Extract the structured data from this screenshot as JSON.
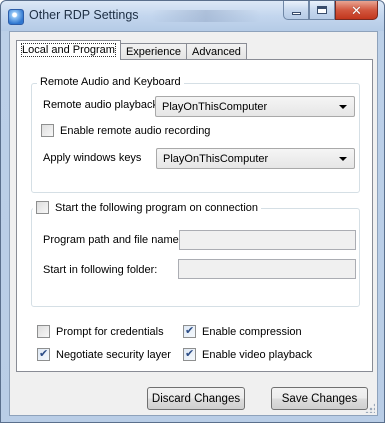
{
  "window": {
    "title": "Other RDP Settings",
    "buttons": {
      "minimize": "minimize",
      "maximize": "maximize",
      "close": "close"
    }
  },
  "tabs": [
    {
      "label": "Local and Program",
      "active": true
    },
    {
      "label": "Experience",
      "active": false
    },
    {
      "label": "Advanced",
      "active": false
    }
  ],
  "audio_group": {
    "title": "Remote Audio and Keyboard",
    "playback_label": "Remote audio playback:",
    "playback_value": "PlayOnThisComputer",
    "recording_label": "Enable remote audio recording",
    "recording_checked": false,
    "keys_label": "Apply windows keys",
    "keys_value": "PlayOnThisComputer"
  },
  "program_group": {
    "title": "Start the following program on connection",
    "title_checked": false,
    "path_label": "Program path and file name:",
    "path_value": "",
    "folder_label": "Start in following folder:",
    "folder_value": ""
  },
  "options": {
    "prompt_credentials": {
      "label": "Prompt for credentials",
      "checked": false
    },
    "enable_compression": {
      "label": "Enable compression",
      "checked": true
    },
    "negotiate_security": {
      "label": "Negotiate security layer",
      "checked": true
    },
    "enable_video": {
      "label": "Enable video playback",
      "checked": true
    }
  },
  "footer": {
    "discard_label": "Discard Changes",
    "save_label": "Save Changes"
  },
  "icons": {
    "app": "rdp-app-icon",
    "check": "checkmark-icon",
    "dropdown": "chevron-down-icon"
  },
  "colors": {
    "frame": "#bcd0e8",
    "close_button": "#c2361d",
    "check": "#2b4c86"
  }
}
